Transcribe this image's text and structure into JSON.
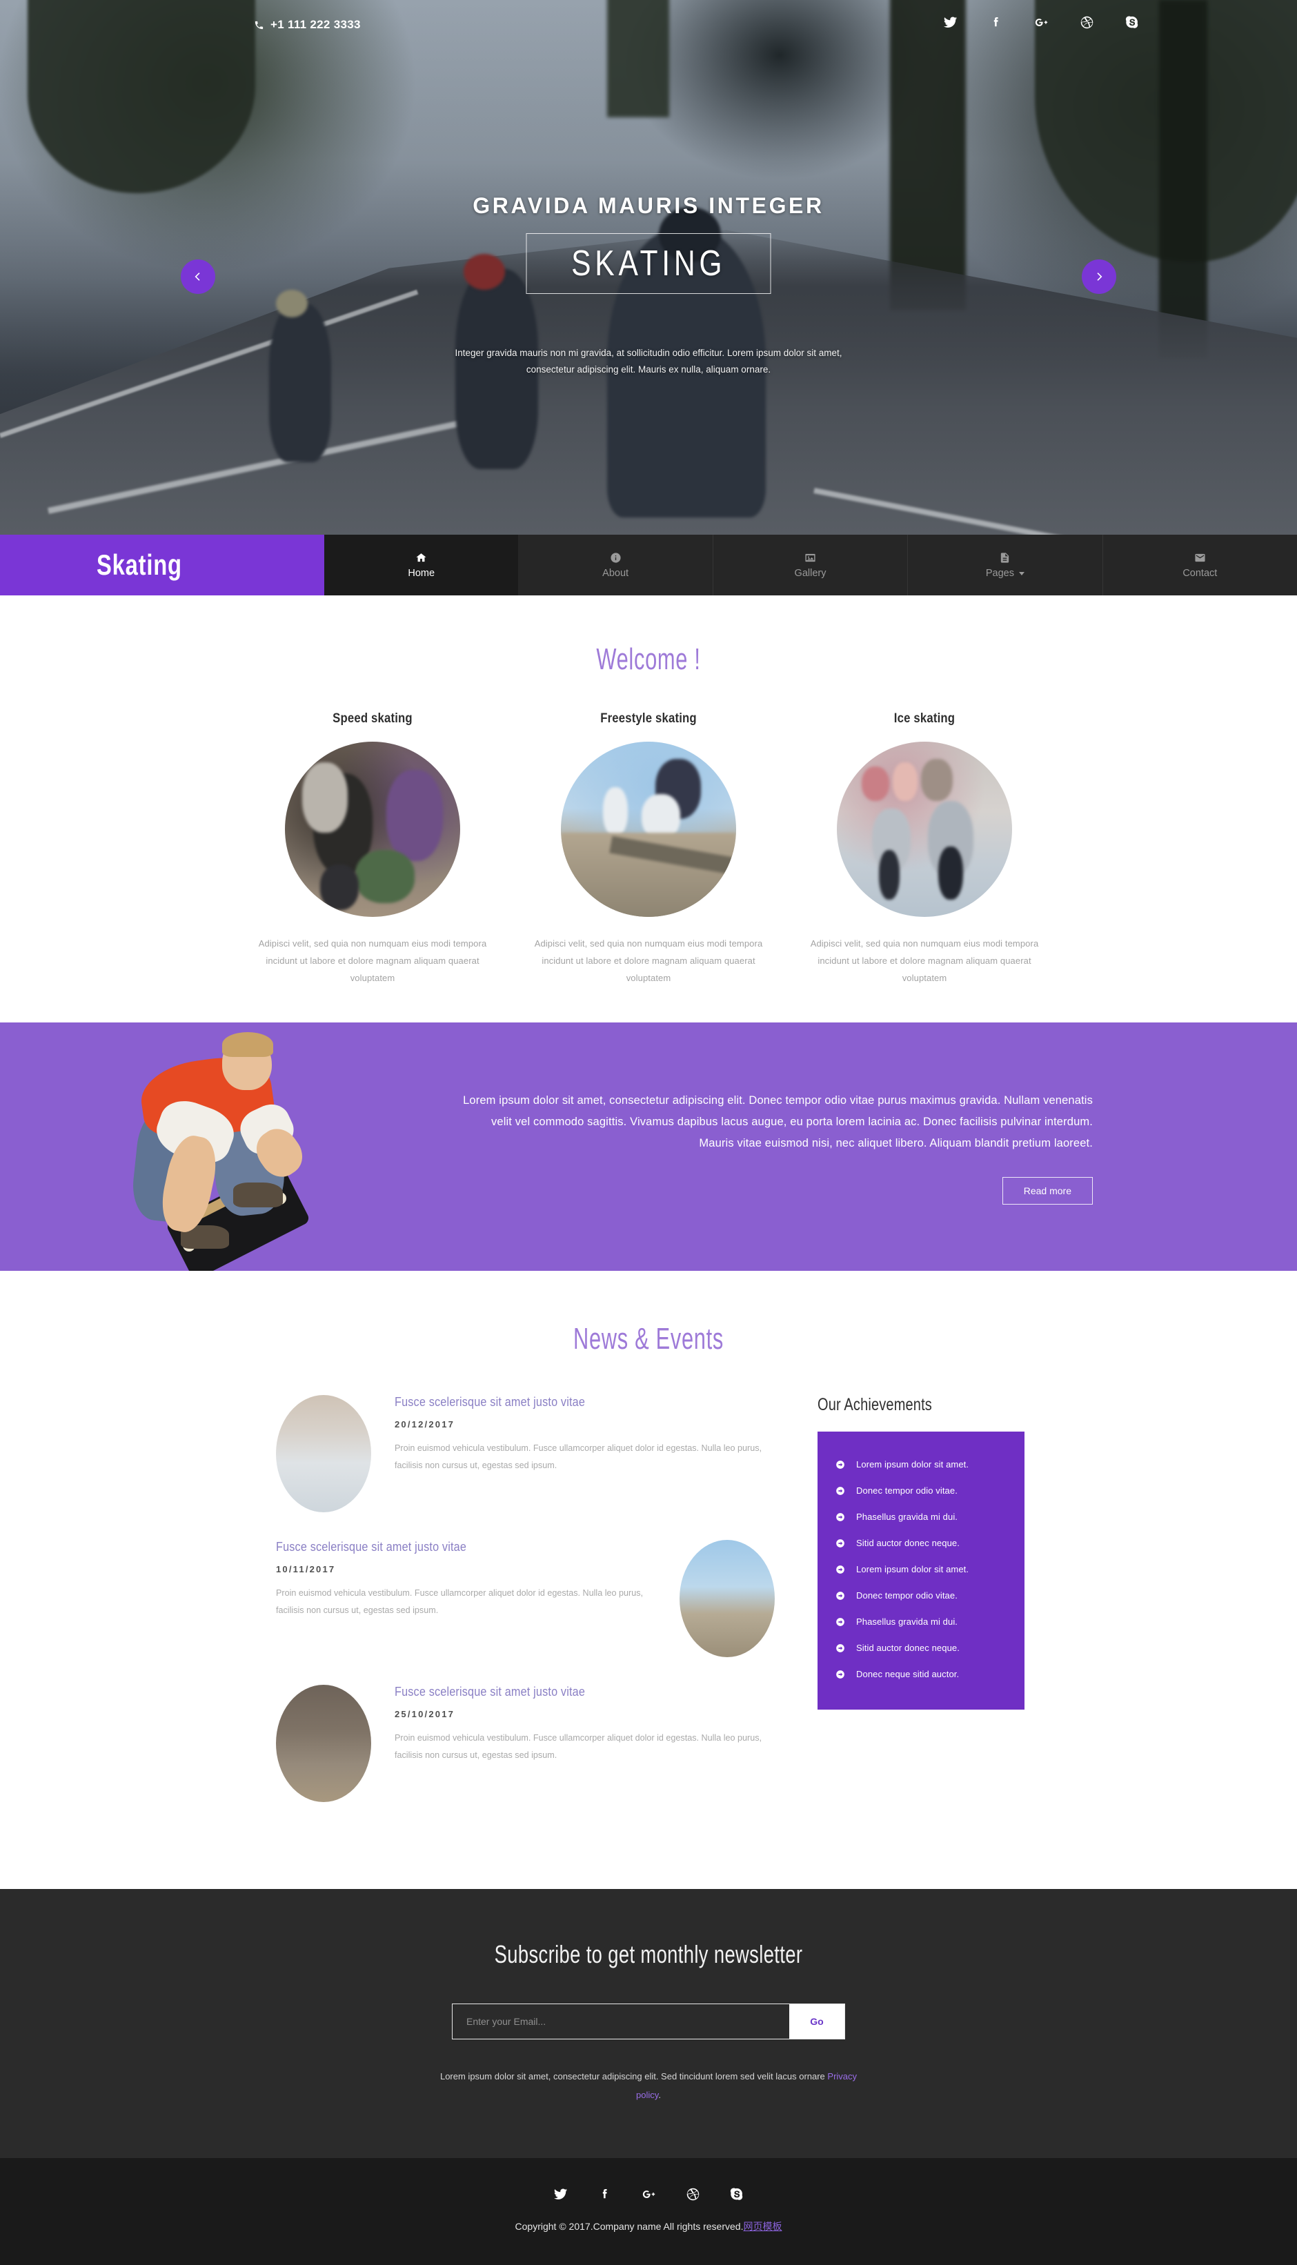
{
  "topbar": {
    "phone": "+1 111 222 3333",
    "phone_icon": "phone-icon",
    "social": [
      {
        "name": "twitter-icon",
        "label": "Twitter"
      },
      {
        "name": "facebook-icon",
        "label": "Facebook"
      },
      {
        "name": "google-plus-icon",
        "label": "Google Plus"
      },
      {
        "name": "dribbble-icon",
        "label": "Dribbble"
      },
      {
        "name": "skype-icon",
        "label": "Skype"
      }
    ]
  },
  "hero": {
    "title": "GRAVIDA MAURIS INTEGER",
    "boxed_word": "SKATING",
    "subtitle": "Integer gravida mauris non mi gravida, at sollicitudin odio efficitur. Lorem ipsum dolor sit amet, consectetur adipiscing elit. Mauris ex nulla, aliquam ornare.",
    "prev_label": "Previous slide",
    "next_label": "Next slide"
  },
  "nav": {
    "brand": "Skating",
    "items": [
      {
        "label": "Home",
        "icon": "home-icon",
        "active": true,
        "caret": false
      },
      {
        "label": "About",
        "icon": "info-circle-icon",
        "active": false,
        "caret": false
      },
      {
        "label": "Gallery",
        "icon": "image-icon",
        "active": false,
        "caret": false
      },
      {
        "label": "Pages",
        "icon": "file-icon",
        "active": false,
        "caret": true
      },
      {
        "label": "Contact",
        "icon": "envelope-icon",
        "active": false,
        "caret": false
      }
    ]
  },
  "welcome": {
    "title": "Welcome !",
    "services": [
      {
        "title": "Speed skating",
        "desc": "Adipisci velit, sed quia non numquam eius modi tempora incidunt ut labore et dolore magnam aliquam quaerat voluptatem"
      },
      {
        "title": "Freestyle skating",
        "desc": "Adipisci velit, sed quia non numquam eius modi tempora incidunt ut labore et dolore magnam aliquam quaerat voluptatem"
      },
      {
        "title": "Ice skating",
        "desc": "Adipisci velit, sed quia non numquam eius modi tempora incidunt ut labore et dolore magnam aliquam quaerat voluptatem"
      }
    ]
  },
  "banner": {
    "text": "Lorem ipsum dolor sit amet, consectetur adipiscing elit. Donec tempor odio vitae purus maximus gravida. Nullam venenatis velit vel commodo sagittis. Vivamus dapibus lacus augue, eu porta lorem lacinia ac. Donec facilisis pulvinar interdum. Mauris vitae euismod nisi, nec aliquet libero. Aliquam blandit pretium laoreet.",
    "button": "Read more",
    "bg_color": "#8a5fd0"
  },
  "news": {
    "title": "News & Events",
    "items": [
      {
        "title": "Fusce scelerisque sit amet justo vitae",
        "date": "20/12/2017",
        "text": "Proin euismod vehicula vestibulum. Fusce ullamcorper aliquet dolor id egestas. Nulla leo purus, facilisis non cursus ut, egestas sed ipsum.",
        "image_side": "left"
      },
      {
        "title": "Fusce scelerisque sit amet justo vitae",
        "date": "10/11/2017",
        "text": "Proin euismod vehicula vestibulum. Fusce ullamcorper aliquet dolor id egestas. Nulla leo purus, facilisis non cursus ut, egestas sed ipsum.",
        "image_side": "right"
      },
      {
        "title": "Fusce scelerisque sit amet justo vitae",
        "date": "25/10/2017",
        "text": "Proin euismod vehicula vestibulum. Fusce ullamcorper aliquet dolor id egestas. Nulla leo purus, facilisis non cursus ut, egestas sed ipsum.",
        "image_side": "left"
      }
    ]
  },
  "achievements": {
    "title": "Our Achievements",
    "box_color": "#6f2fc4",
    "bullet_icon": "arrow-circle-right-icon",
    "items": [
      "Lorem ipsum dolor sit amet.",
      "Donec tempor odio vitae.",
      "Phasellus gravida mi dui.",
      "Sitid auctor donec neque.",
      "Lorem ipsum dolor sit amet.",
      "Donec tempor odio vitae.",
      "Phasellus gravida mi dui.",
      "Sitid auctor donec neque.",
      "Donec neque sitid auctor."
    ]
  },
  "subscribe": {
    "title": "Subscribe to get monthly newsletter",
    "placeholder": "Enter your Email...",
    "value": "",
    "button": "Go",
    "note_before": "Lorem ipsum dolor sit amet, consectetur adipiscing elit. Sed tincidunt lorem sed velit lacus ornare ",
    "note_link": "Privacy policy",
    "note_after": "."
  },
  "footer": {
    "social": [
      {
        "name": "twitter-icon",
        "label": "Twitter"
      },
      {
        "name": "facebook-icon",
        "label": "Facebook"
      },
      {
        "name": "google-plus-icon",
        "label": "Google Plus"
      },
      {
        "name": "dribbble-icon",
        "label": "Dribbble"
      },
      {
        "name": "skype-icon",
        "label": "Skype"
      }
    ],
    "copyright": "Copyright © 2017.Company name All rights reserved.",
    "copyright_link": "网页模板"
  },
  "colors": {
    "brand_purple": "#7a36d6",
    "banner_purple": "#8a5fd0",
    "achievements_purple": "#6f2fc4",
    "heading_purple": "#9e7ad8",
    "nav_dark": "#262626",
    "nav_active": "#1b1b1b",
    "subscribe_bg": "#2b2b2b",
    "footer_bg": "#1a1a1a"
  }
}
